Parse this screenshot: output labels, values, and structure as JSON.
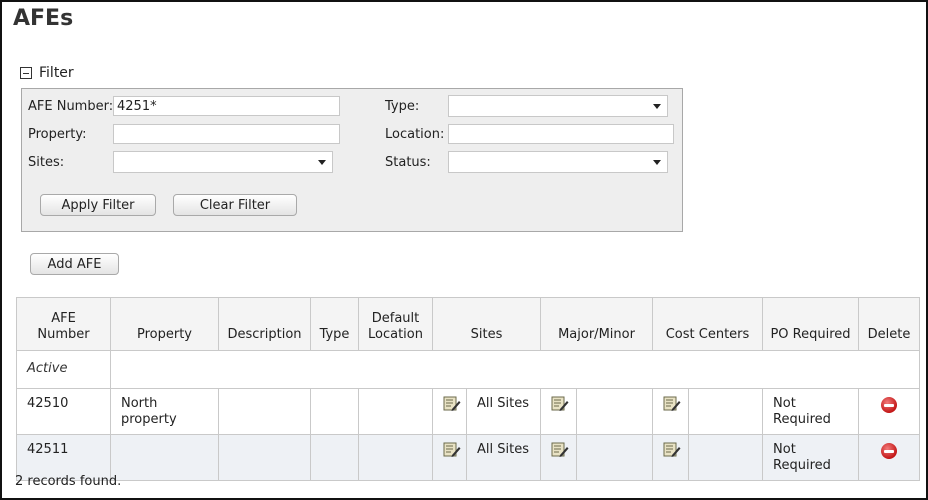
{
  "page": {
    "title": "AFEs"
  },
  "filter": {
    "toggle_label": "Filter",
    "afe_number_label": "AFE Number:",
    "afe_number_value": "4251*",
    "property_label": "Property:",
    "property_value": "",
    "sites_label": "Sites:",
    "sites_value": "",
    "type_label": "Type:",
    "type_value": "",
    "location_label": "Location:",
    "location_value": "",
    "status_label": "Status:",
    "status_value": "",
    "apply_label": "Apply Filter",
    "clear_label": "Clear Filter"
  },
  "actions": {
    "add_label": "Add AFE"
  },
  "table": {
    "columns": {
      "afe_number": "AFE Number",
      "property": "Property",
      "description": "Description",
      "type": "Type",
      "default_location": "Default Location",
      "sites": "Sites",
      "major_minor": "Major/Minor",
      "cost_centers": "Cost Centers",
      "po_required": "PO Required",
      "delete": "Delete"
    },
    "group_label": "Active",
    "rows": [
      {
        "afe_number": "42510",
        "property": "North property",
        "description": "",
        "type": "",
        "default_location": "",
        "sites": "All Sites",
        "major_minor": "",
        "cost_centers": "",
        "po_required": "Not Required"
      },
      {
        "afe_number": "42511",
        "property": "",
        "description": "",
        "type": "",
        "default_location": "",
        "sites": "All Sites",
        "major_minor": "",
        "cost_centers": "",
        "po_required": "Not Required"
      }
    ]
  },
  "footer": {
    "records_text": "2 records found."
  },
  "icons": {
    "collapse": "minus-box-icon",
    "edit": "edit-note-icon",
    "delete": "delete-circle-icon"
  },
  "colors": {
    "link": "#1f5f8a",
    "delete_red": "#c31818",
    "panel_bg": "#eeeeee"
  }
}
